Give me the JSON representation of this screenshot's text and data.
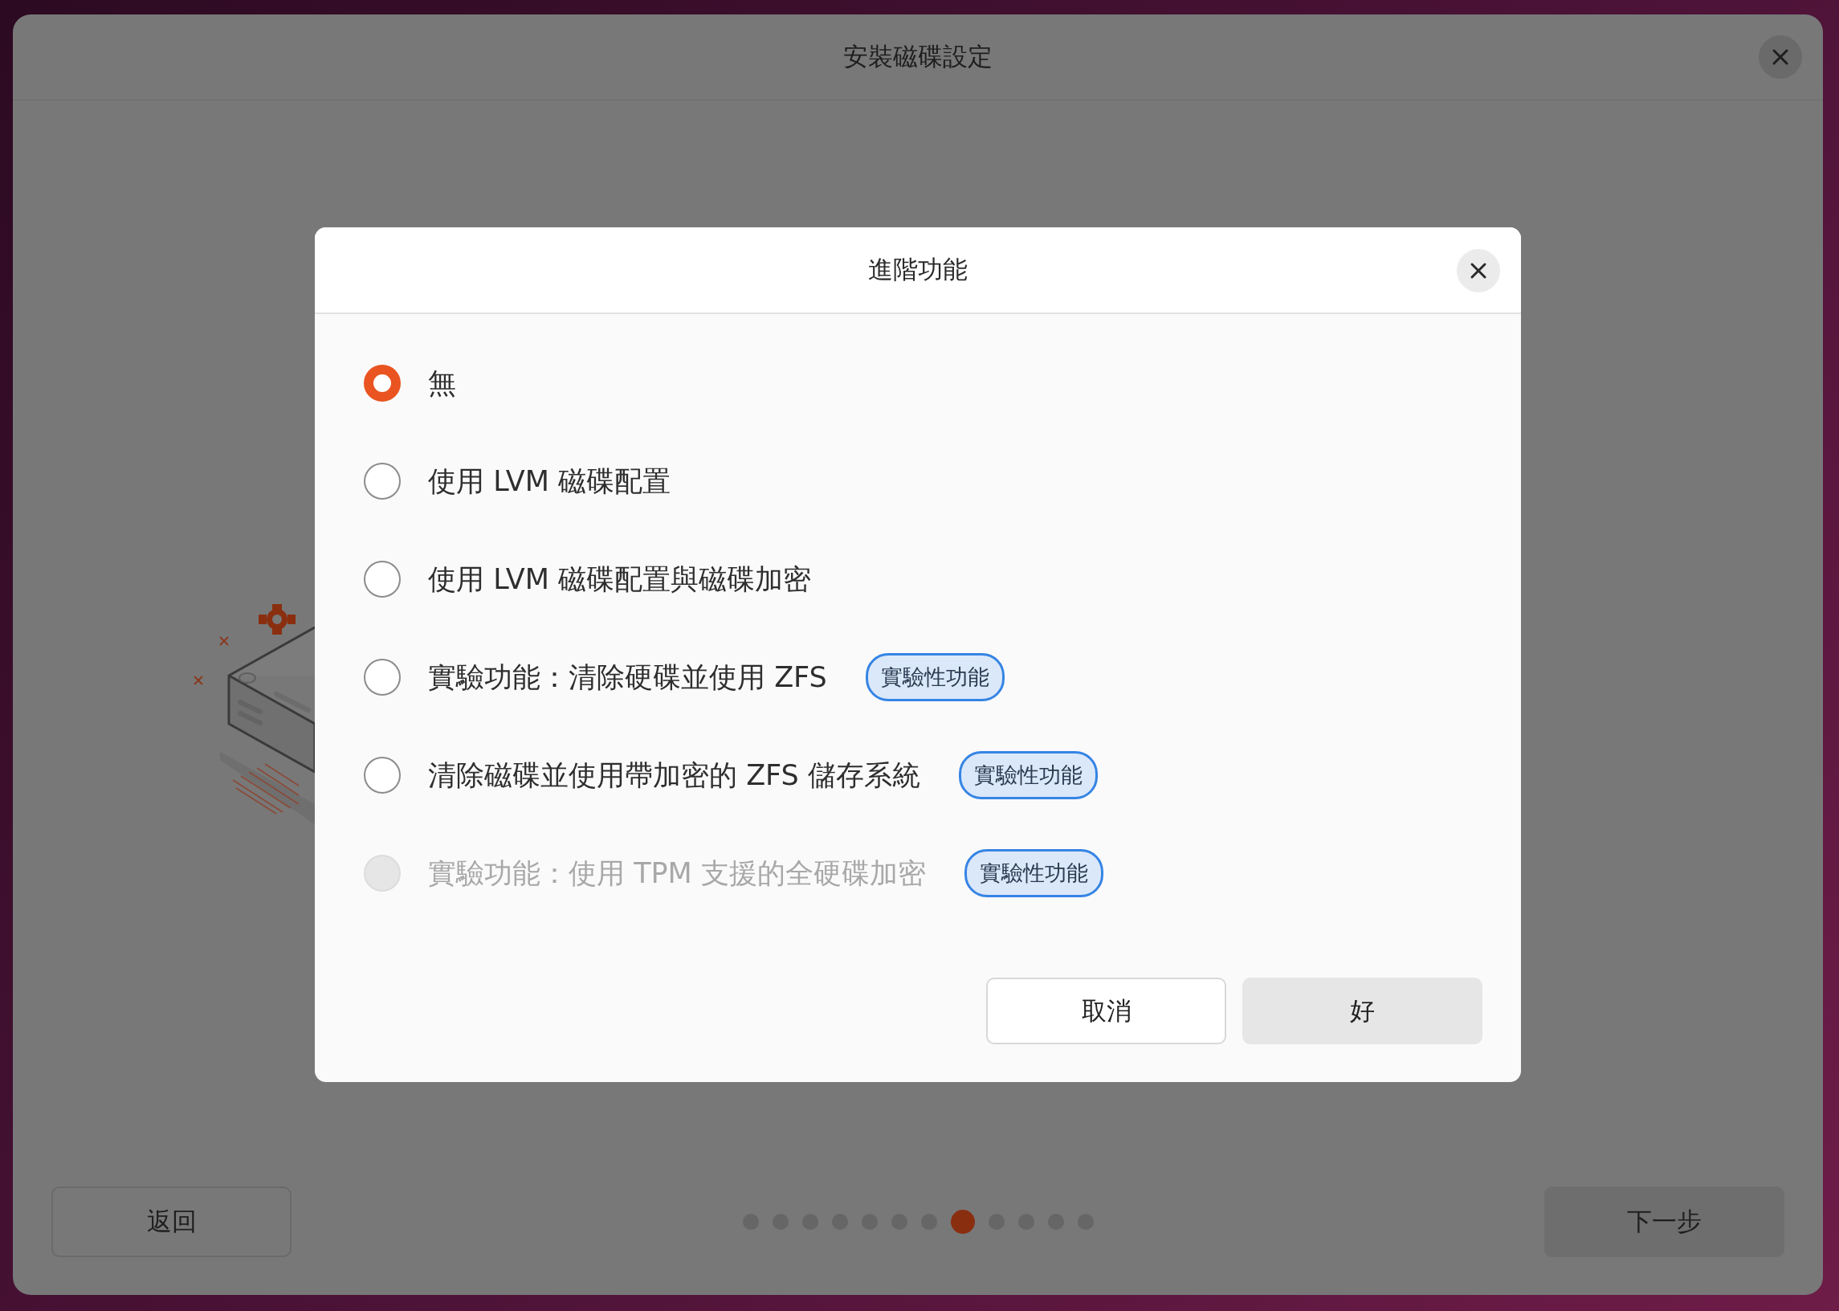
{
  "window": {
    "title": "安裝磁碟設定"
  },
  "dialog": {
    "title": "進階功能",
    "options": [
      {
        "label": "無",
        "selected": true,
        "disabled": false
      },
      {
        "label": "使用 LVM 磁碟配置",
        "selected": false,
        "disabled": false
      },
      {
        "label": "使用 LVM 磁碟配置與磁碟加密",
        "selected": false,
        "disabled": false
      },
      {
        "label": "實驗功能：清除硬碟並使用 ZFS",
        "selected": false,
        "disabled": false,
        "badge": "實驗性功能"
      },
      {
        "label": "清除磁碟並使用帶加密的 ZFS 儲存系統",
        "selected": false,
        "disabled": false,
        "badge": "實驗性功能"
      },
      {
        "label": "實驗功能：使用 TPM 支援的全硬碟加密",
        "selected": false,
        "disabled": true,
        "badge": "實驗性功能"
      }
    ],
    "buttons": [
      {
        "label": "取消",
        "kind": "outline"
      },
      {
        "label": "好",
        "kind": "filled"
      }
    ]
  },
  "navigation": {
    "back": {
      "label": "返回",
      "kind": "outline"
    },
    "next": {
      "label": "下一步",
      "kind": "filled"
    },
    "pages": [
      {
        "selected": false
      },
      {
        "selected": false
      },
      {
        "selected": false
      },
      {
        "selected": false
      },
      {
        "selected": false
      },
      {
        "selected": false
      },
      {
        "selected": false
      },
      {
        "selected": true
      },
      {
        "selected": false
      },
      {
        "selected": false
      },
      {
        "selected": false
      },
      {
        "selected": false
      }
    ]
  }
}
